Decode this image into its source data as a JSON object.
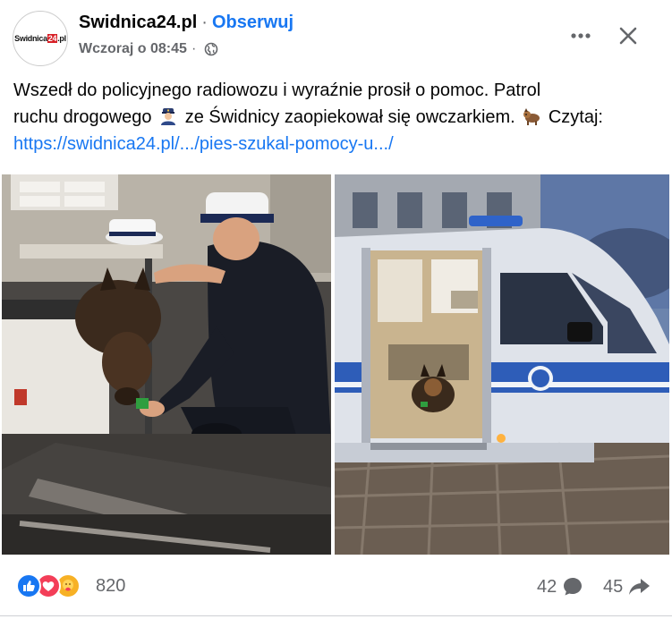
{
  "header": {
    "page_name": "Swidnica24.pl",
    "separator": "·",
    "follow_label": "Obserwuj",
    "timestamp": "Wczoraj o 08:45",
    "meta_separator": "·",
    "privacy_icon": "globe-icon",
    "logo": {
      "part1": "Swidnica",
      "part2": "24",
      "part3": ".pl"
    }
  },
  "post": {
    "text_line1": "Wszedł do policyjnego radiowozu i wyraźnie prosił o pomoc. Patrol",
    "text_line2a": "ruchu drogowego",
    "text_line2b": "ze Świdnicy zaopiekował się owczarkiem.",
    "text_line2c": "Czytaj:",
    "link": "https://swidnica24.pl/.../pies-szukal-pomocy-u.../",
    "emojis": [
      "police-officer-emoji",
      "dog-emoji"
    ]
  },
  "photos": [
    {
      "name": "photo-officer-feeding-dog"
    },
    {
      "name": "photo-police-van-with-dog"
    }
  ],
  "footer": {
    "reaction_icons": [
      "like-icon",
      "love-icon",
      "care-icon"
    ],
    "reaction_count": "820",
    "comments_count": "42",
    "shares_count": "45"
  },
  "colors": {
    "accent": "#1877f2",
    "secondary_text": "#65676b",
    "brand_red": "#d71f26"
  }
}
